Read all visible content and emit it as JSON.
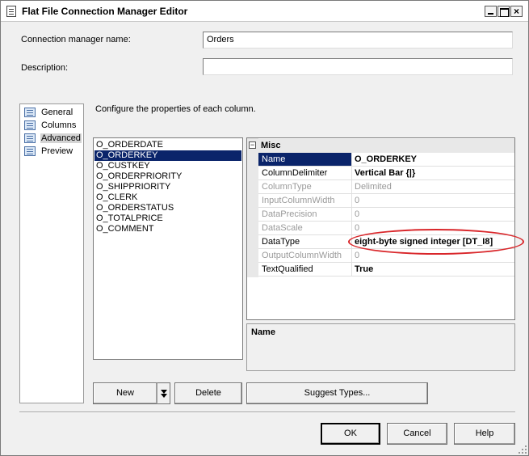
{
  "window": {
    "title": "Flat File Connection Manager Editor"
  },
  "form": {
    "connection_name_label": "Connection manager name:",
    "connection_name_value": "Orders",
    "description_label": "Description:",
    "description_value": ""
  },
  "nav": {
    "items": [
      {
        "label": "General",
        "icon": "general-page-icon"
      },
      {
        "label": "Columns",
        "icon": "columns-page-icon"
      },
      {
        "label": "Advanced",
        "icon": "advanced-page-icon",
        "selected": true
      },
      {
        "label": "Preview",
        "icon": "preview-page-icon"
      }
    ]
  },
  "advanced": {
    "instructions": "Configure the properties of each column.",
    "columns": [
      "O_ORDERDATE",
      "O_ORDERKEY",
      "O_CUSTKEY",
      "O_ORDERPRIORITY",
      "O_SHIPPRIORITY",
      "O_CLERK",
      "O_ORDERSTATUS",
      "O_TOTALPRICE",
      "O_COMMENT"
    ],
    "selected_column": "O_ORDERKEY",
    "properties": {
      "category": "Misc",
      "toggle": "−",
      "rows": [
        {
          "name": "Name",
          "value": "O_ORDERKEY"
        },
        {
          "name": "ColumnDelimiter",
          "value": "Vertical Bar {|}"
        },
        {
          "name": "ColumnType",
          "value": "Delimited"
        },
        {
          "name": "InputColumnWidth",
          "value": "0"
        },
        {
          "name": "DataPrecision",
          "value": "0"
        },
        {
          "name": "DataScale",
          "value": "0"
        },
        {
          "name": "DataType",
          "value": "eight-byte signed integer [DT_I8]"
        },
        {
          "name": "OutputColumnWidth",
          "value": "0"
        },
        {
          "name": "TextQualified",
          "value": "True"
        }
      ]
    },
    "description_title": "Name",
    "buttons": {
      "new": "New",
      "delete": "Delete",
      "suggest": "Suggest Types..."
    }
  },
  "footer": {
    "ok": "OK",
    "cancel": "Cancel",
    "help": "Help"
  },
  "colors": {
    "selection": "#0a246a",
    "annotation": "#d9262a",
    "dialog_bg": "#f0f0f0"
  }
}
